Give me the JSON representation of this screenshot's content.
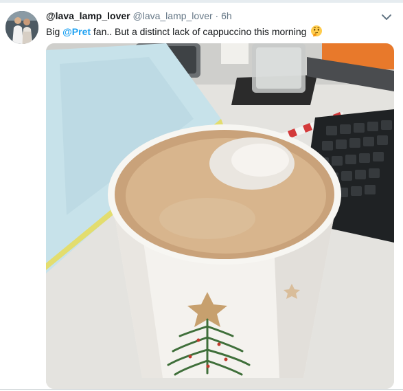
{
  "tweet": {
    "display_name": "@lava_lamp_lover",
    "handle": "@lava_lamp_lover",
    "separator": "·",
    "time": "6h",
    "text_before": "Big ",
    "mention": "@Pret",
    "text_after": " fan.. But a distinct lack of cappuccino this morning",
    "emoji": "thinking-face-icon",
    "menu_icon": "chevron-down-icon"
  },
  "colors": {
    "mention": "#1da1f2",
    "secondary_text": "#657786",
    "primary_text": "#14171a"
  }
}
